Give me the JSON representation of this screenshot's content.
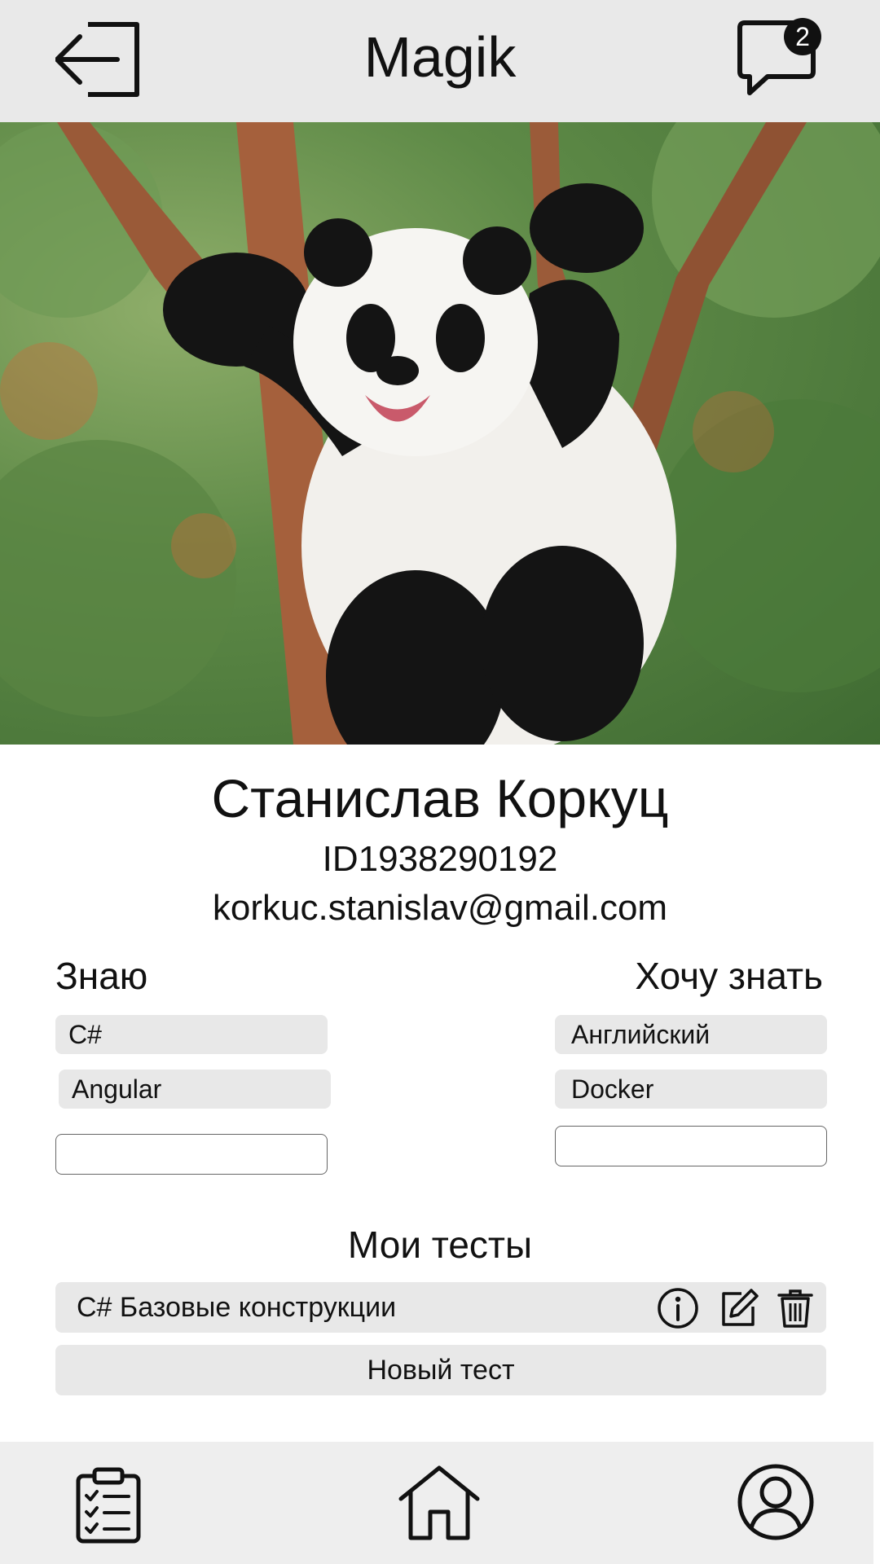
{
  "app": {
    "title": "Magik"
  },
  "header": {
    "unread_count": "2"
  },
  "profile": {
    "name": "Станислав Коркуц",
    "id": "ID1938290192",
    "email": "korkuc.stanislav@gmail.com"
  },
  "skills": {
    "know_title": "Знаю",
    "know_items": [
      "C#",
      "Angular"
    ],
    "want_title": "Хочу знать",
    "want_items": [
      "Английский",
      "Docker"
    ]
  },
  "tests": {
    "title": "Мои тесты",
    "items": [
      {
        "label": "C# Базовые конструкции"
      }
    ],
    "new_label": "Новый тест"
  },
  "icons": {
    "logout": "logout-icon",
    "messages": "chat-bubble-icon",
    "info": "info-icon",
    "edit": "edit-icon",
    "delete": "trash-icon",
    "tests_nav": "clipboard-checklist-icon",
    "home_nav": "home-icon",
    "profile_nav": "user-circle-icon"
  }
}
